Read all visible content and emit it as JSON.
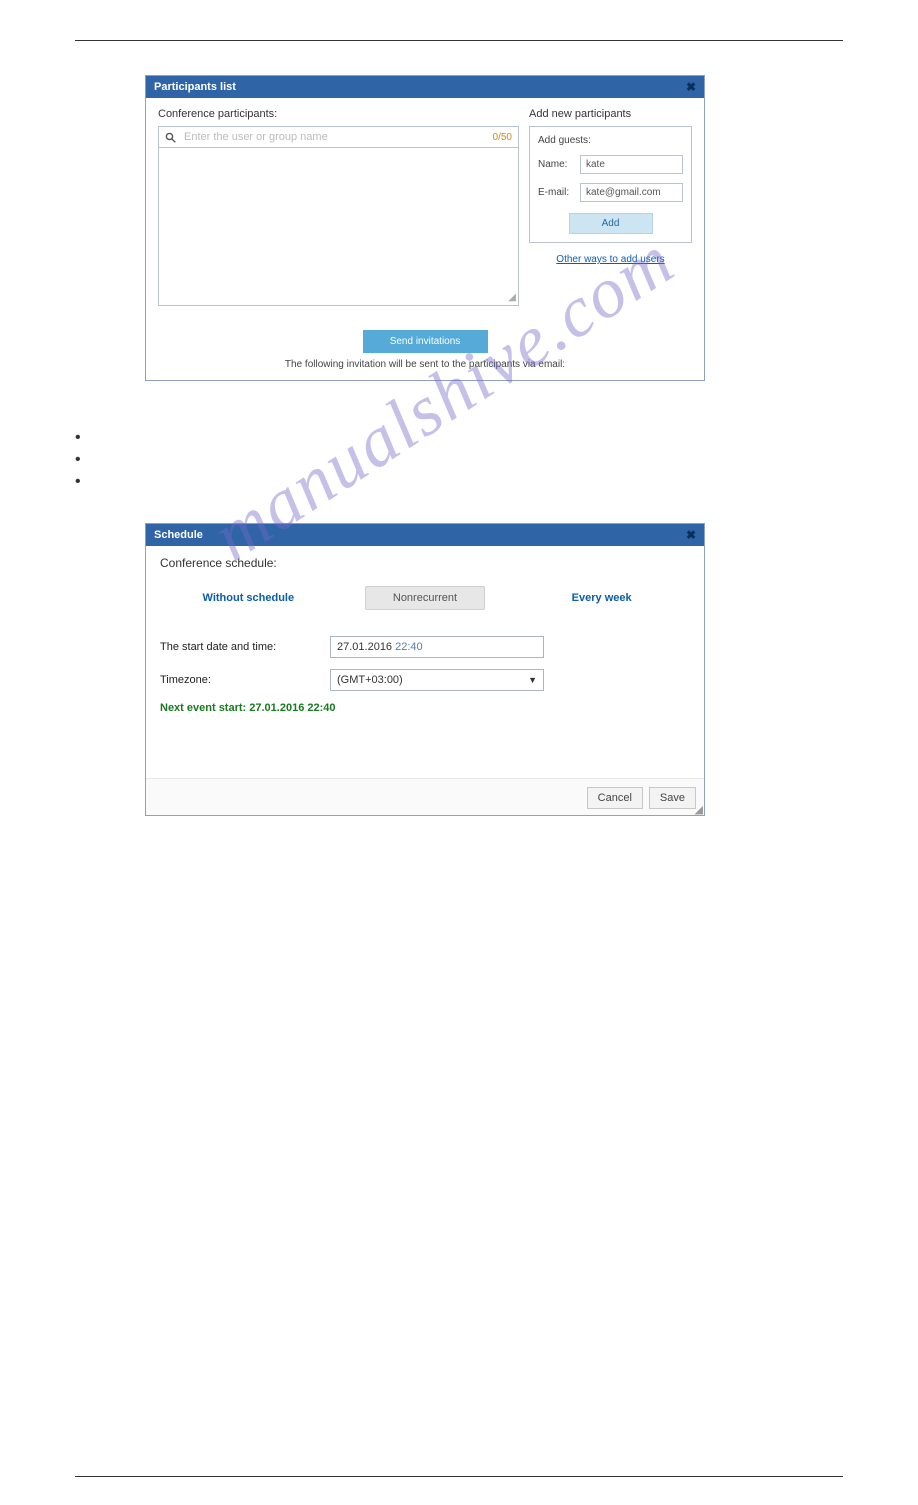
{
  "watermark": "manualshive.com",
  "participants_panel": {
    "title": "Participants list",
    "close_glyph": "✖",
    "left_label": "Conference participants:",
    "search_placeholder": "Enter the user or group name",
    "counter": "0/50",
    "right_label": "Add new participants",
    "add_guests_label": "Add guests:",
    "name_label": "Name:",
    "name_value": "kate",
    "email_label": "E-mail:",
    "email_value": "kate@gmail.com",
    "add_button": "Add",
    "other_link": "Other ways to add users",
    "send_button": "Send invitations",
    "note": "The following invitation will be sent to the participants via email:"
  },
  "schedule_panel": {
    "title": "Schedule",
    "close_glyph": "✖",
    "label": "Conference schedule:",
    "tabs": {
      "without": "Without schedule",
      "nonrecurrent": "Nonrecurrent",
      "every_week": "Every week"
    },
    "start_label": "The start date and time:",
    "start_date": "27.01.2016 ",
    "start_time": "22:40",
    "timezone_label": "Timezone:",
    "timezone_value": "(GMT+03:00)",
    "next_event": "Next event start: 27.01.2016 22:40",
    "cancel": "Cancel",
    "save": "Save"
  },
  "footer_link": ""
}
